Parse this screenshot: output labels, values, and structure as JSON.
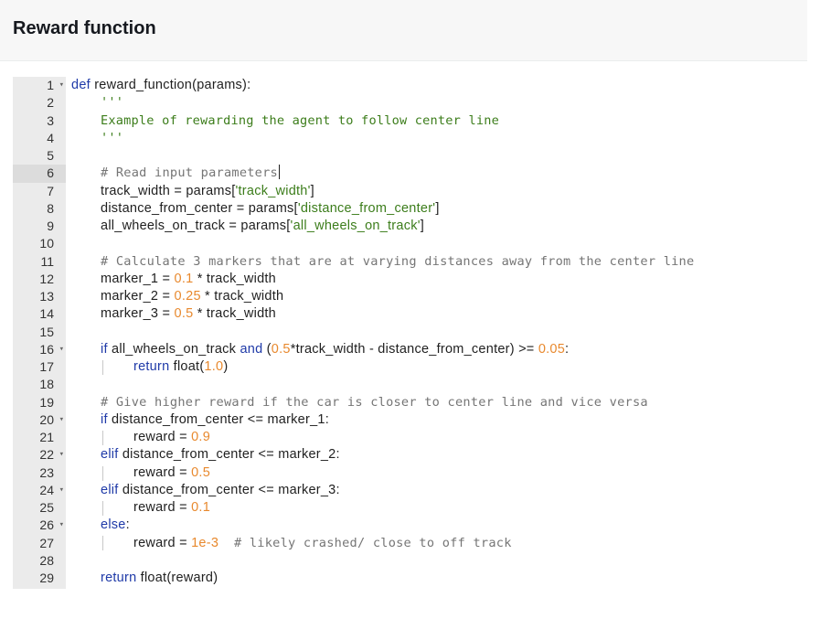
{
  "header": {
    "title": "Reward function"
  },
  "editor": {
    "active_line": 6,
    "lines": [
      {
        "n": "1",
        "fold": true
      },
      {
        "n": "2"
      },
      {
        "n": "3"
      },
      {
        "n": "4"
      },
      {
        "n": "5"
      },
      {
        "n": "6"
      },
      {
        "n": "7"
      },
      {
        "n": "8"
      },
      {
        "n": "9"
      },
      {
        "n": "10"
      },
      {
        "n": "11"
      },
      {
        "n": "12"
      },
      {
        "n": "13"
      },
      {
        "n": "14"
      },
      {
        "n": "15"
      },
      {
        "n": "16",
        "fold": true
      },
      {
        "n": "17"
      },
      {
        "n": "18"
      },
      {
        "n": "19"
      },
      {
        "n": "20",
        "fold": true
      },
      {
        "n": "21"
      },
      {
        "n": "22",
        "fold": true
      },
      {
        "n": "23"
      },
      {
        "n": "24",
        "fold": true
      },
      {
        "n": "25"
      },
      {
        "n": "26",
        "fold": true
      },
      {
        "n": "27"
      },
      {
        "n": "28"
      },
      {
        "n": "29"
      }
    ],
    "code": {
      "l1_kw": "def",
      "l1_rest": " reward_function(params):",
      "l2": "'''",
      "l3": "Example of rewarding the agent to follow center line",
      "l4": "'''",
      "l6": "# Read input parameters",
      "l7_a": "track_width = params[",
      "l7_s": "'track_width'",
      "l7_b": "]",
      "l8_a": "distance_from_center = params[",
      "l8_s": "'distance_from_center'",
      "l8_b": "]",
      "l9_a": "all_wheels_on_track = params[",
      "l9_s": "'all_wheels_on_track'",
      "l9_b": "]",
      "l11": "# Calculate 3 markers that are at varying distances away from the center line",
      "l12_a": "marker_1 = ",
      "l12_n": "0.1",
      "l12_b": " * track_width",
      "l13_a": "marker_2 = ",
      "l13_n": "0.25",
      "l13_b": " * track_width",
      "l14_a": "marker_3 = ",
      "l14_n": "0.5",
      "l14_b": " * track_width",
      "l16_kw": "if",
      "l16_a": " all_wheels_on_track ",
      "l16_and": "and",
      "l16_b": " (",
      "l16_n1": "0.5",
      "l16_c": "*track_width - distance_from_center) >= ",
      "l16_n2": "0.05",
      "l16_d": ":",
      "l17_kw": "return",
      "l17_a": " float(",
      "l17_n": "1.0",
      "l17_b": ")",
      "l19": "# Give higher reward if the car is closer to center line and vice versa",
      "l20_kw": "if",
      "l20_a": " distance_from_center <= marker_1:",
      "l21_a": "reward = ",
      "l21_n": "0.9",
      "l22_kw": "elif",
      "l22_a": " distance_from_center <= marker_2:",
      "l23_a": "reward = ",
      "l23_n": "0.5",
      "l24_kw": "elif",
      "l24_a": " distance_from_center <= marker_3:",
      "l25_a": "reward = ",
      "l25_n": "0.1",
      "l26_kw": "else",
      "l26_a": ":",
      "l27_a": "reward = ",
      "l27_n": "1e-3",
      "l27_c": "  # likely crashed/ close to off track",
      "l29_kw": "return",
      "l29_a": " float(reward)"
    }
  }
}
